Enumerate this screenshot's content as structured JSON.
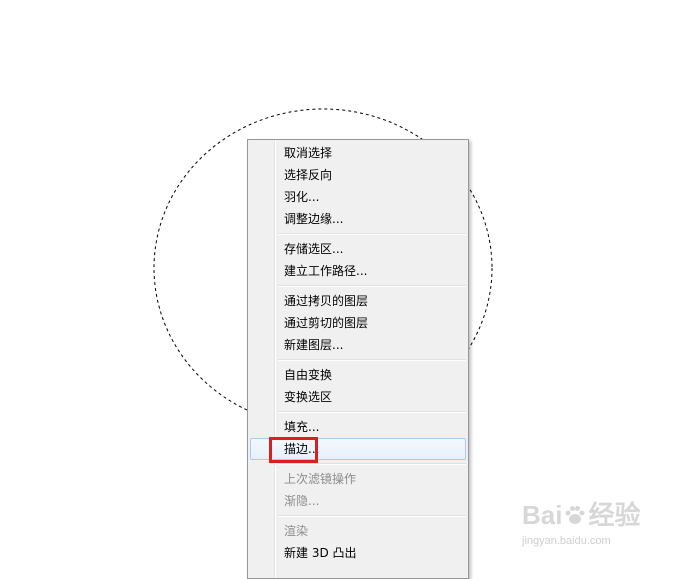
{
  "context_menu": {
    "groups": [
      [
        {
          "label": "取消选择",
          "enabled": true
        },
        {
          "label": "选择反向",
          "enabled": true
        },
        {
          "label": "羽化...",
          "enabled": true
        },
        {
          "label": "调整边缘...",
          "enabled": true
        }
      ],
      [
        {
          "label": "存储选区...",
          "enabled": true
        },
        {
          "label": "建立工作路径...",
          "enabled": true
        }
      ],
      [
        {
          "label": "通过拷贝的图层",
          "enabled": true
        },
        {
          "label": "通过剪切的图层",
          "enabled": true
        },
        {
          "label": "新建图层...",
          "enabled": true
        }
      ],
      [
        {
          "label": "自由变换",
          "enabled": true
        },
        {
          "label": "变换选区",
          "enabled": true
        }
      ],
      [
        {
          "label": "填充...",
          "enabled": true
        },
        {
          "label": "描边...",
          "enabled": true,
          "highlighted": true
        }
      ],
      [
        {
          "label": "上次滤镜操作",
          "enabled": false
        },
        {
          "label": "渐隐...",
          "enabled": false
        }
      ],
      [
        {
          "label": "渲染",
          "enabled": false
        },
        {
          "label": "新建 3D 凸出",
          "enabled": true
        }
      ]
    ]
  },
  "watermark": {
    "logo_text_left": "Bai",
    "logo_text_right": "经验",
    "url": "jingyan.baidu.com"
  },
  "colors": {
    "annotation": "#d8201f",
    "menu_bg": "#f0f0f0",
    "highlight_border": "#a8cbef",
    "disabled_text": "#8d8d8d"
  }
}
